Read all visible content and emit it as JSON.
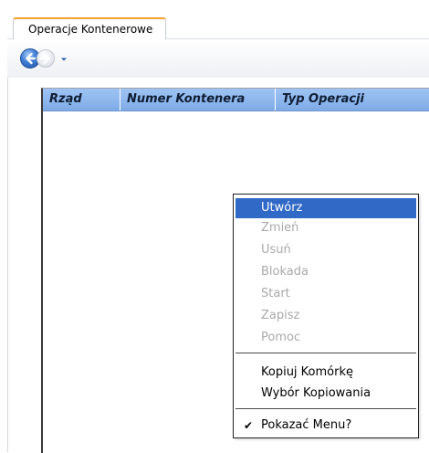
{
  "tabs": [
    {
      "label": "Operacje Kontenerowe",
      "active": true,
      "accent": "#f0a32c"
    }
  ],
  "toolbar": {
    "back_icon": "back-arrow-icon",
    "forward_icon": "forward-arrow-icon",
    "dropdown_icon": "chevron-down-icon"
  },
  "grid": {
    "header_color": "#8fb8ee",
    "columns": [
      "Rząd",
      "Numer Kontenera",
      "Typ Operacji"
    ],
    "rows": []
  },
  "context_menu": {
    "highlight_color": "#3169c6",
    "items": [
      {
        "label": "Utwórz",
        "enabled": true,
        "highlighted": true
      },
      {
        "label": "Zmień",
        "enabled": false
      },
      {
        "label": "Usuń",
        "enabled": false
      },
      {
        "label": "Blokada",
        "enabled": false
      },
      {
        "label": "Start",
        "enabled": false
      },
      {
        "label": "Zapisz",
        "enabled": false
      },
      {
        "label": "Pomoc",
        "enabled": false
      },
      {
        "label": "Kopiuj Komórkę",
        "enabled": true
      },
      {
        "label": "Wybór Kopiowania",
        "enabled": true
      },
      {
        "label": "Pokazać Menu?",
        "enabled": true,
        "checked": true
      }
    ],
    "check_glyph": "✔"
  }
}
